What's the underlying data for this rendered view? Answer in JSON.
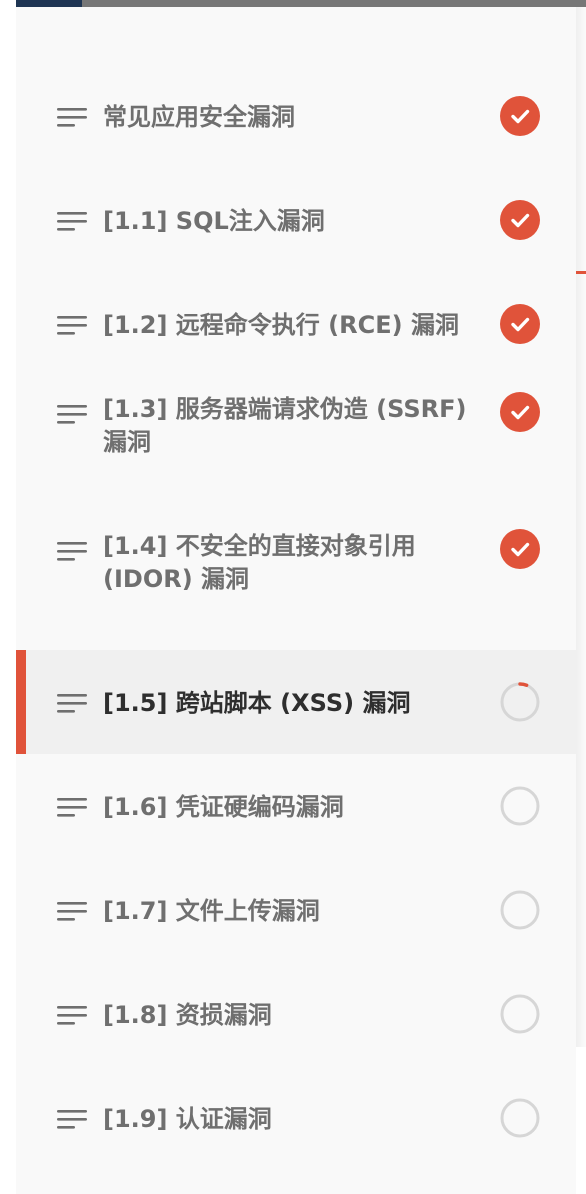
{
  "colors": {
    "accent": "#e0533a",
    "text": "#6f6f6f",
    "active_text": "#2e2e2e",
    "incomplete_ring": "#d6d6d6",
    "panel_bg": "#f9f9f9",
    "active_bg": "#f0f0f0",
    "header_dark": "#1f3553"
  },
  "icons": {
    "lesson": "hamburger-lines-icon",
    "completed": "check-circle-icon",
    "in_progress": "progress-ring-icon",
    "not_started": "empty-circle-icon"
  },
  "lessons": [
    {
      "title": "常见应用安全漏洞",
      "status": "completed",
      "active": false
    },
    {
      "title": "[1.1] SQL注入漏洞",
      "status": "completed",
      "active": false
    },
    {
      "title": "[1.2] 远程命令执行 (RCE) 漏洞",
      "status": "completed",
      "active": false
    },
    {
      "title": "[1.3] 服务器端请求伪造 (SSRF) 漏洞",
      "status": "completed",
      "active": false
    },
    {
      "title": "[1.4] 不安全的直接对象引用 (IDOR) 漏洞",
      "status": "completed",
      "active": false
    },
    {
      "title": "[1.5] 跨站脚本 (XSS) 漏洞",
      "status": "in_progress",
      "progress": 0.06,
      "active": true
    },
    {
      "title": "[1.6] 凭证硬编码漏洞",
      "status": "not_started",
      "active": false
    },
    {
      "title": "[1.7] 文件上传漏洞",
      "status": "not_started",
      "active": false
    },
    {
      "title": "[1.8] 资损漏洞",
      "status": "not_started",
      "active": false
    },
    {
      "title": "[1.9] 认证漏洞",
      "status": "not_started",
      "active": false
    }
  ]
}
